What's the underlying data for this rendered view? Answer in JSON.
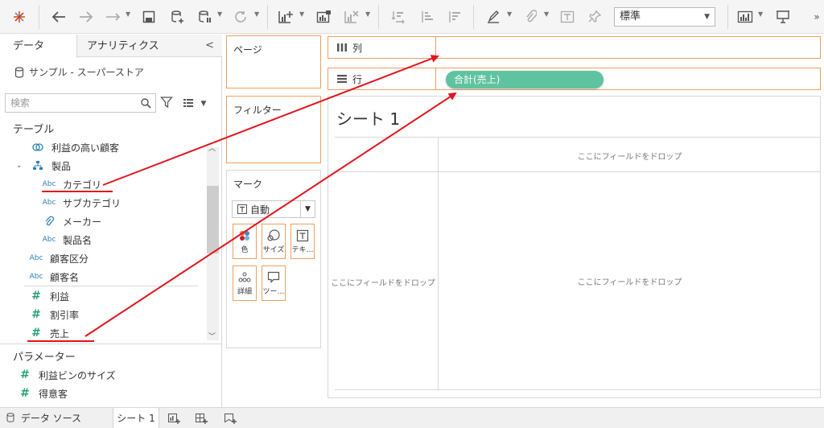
{
  "toolbar": {
    "style_select": "標準",
    "overflow": "»"
  },
  "datapane": {
    "tab_data": "データ",
    "tab_analytics": "アナリティクス",
    "collapse": "<",
    "datasource": "サンプル - スーパーストア",
    "search_placeholder": "検索",
    "tables_title": "テーブル",
    "fields": [
      {
        "type": "set",
        "label": "利益の高い顧客"
      },
      {
        "type": "hierarchy",
        "label": "製品"
      },
      {
        "type": "Abc",
        "label": "カテゴリ"
      },
      {
        "type": "Abc",
        "label": "サブカテゴリ"
      },
      {
        "type": "clip",
        "label": "メーカー"
      },
      {
        "type": "Abc",
        "label": "製品名"
      },
      {
        "type": "Abc",
        "label": "顧客区分"
      },
      {
        "type": "Abc",
        "label": "顧客名"
      },
      {
        "type": "#",
        "label": "利益"
      },
      {
        "type": "#",
        "label": "割引率"
      },
      {
        "type": "#",
        "label": "売上"
      }
    ],
    "params_title": "パラメーター",
    "params": [
      {
        "type": "#",
        "label": "利益ビンのサイズ"
      },
      {
        "type": "#",
        "label": "得意客"
      }
    ]
  },
  "shelves": {
    "pages": "ページ",
    "filters": "フィルター",
    "columns": "列",
    "rows": "行",
    "rows_pill": "合計(売上)"
  },
  "marks": {
    "title": "マーク",
    "type": "自動",
    "buttons": [
      "色",
      "サイズ",
      "テキ…",
      "詳細",
      "ツー…"
    ]
  },
  "canvas": {
    "sheet_title": "シート 1",
    "drop_top": "ここにフィールドをドロップ",
    "drop_left": "ここにフィールドをドロップ",
    "drop_center": "ここにフィールドをドロップ"
  },
  "bottom": {
    "datasource_tab": "データ ソース",
    "sheet_tab": "シート 1"
  },
  "colors": {
    "shelf_border": "#f0a05a",
    "pill": "#5fc3a0",
    "annotation": "#e3131b"
  }
}
